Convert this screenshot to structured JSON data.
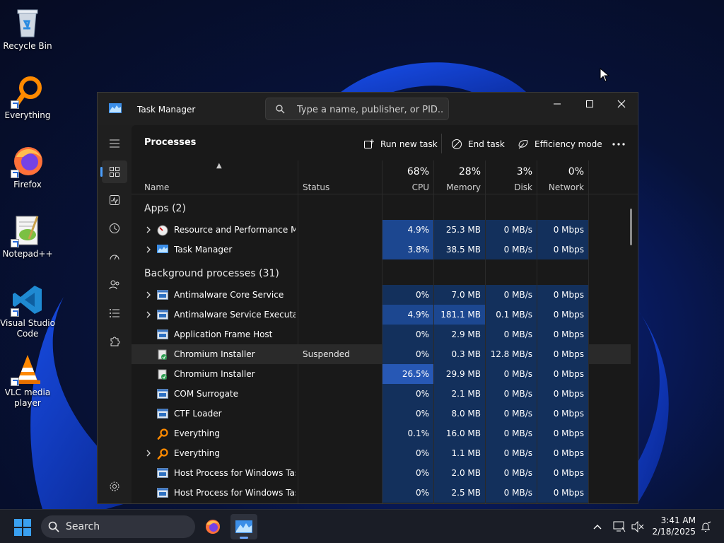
{
  "desktop": {
    "icons": [
      {
        "label": "Recycle Bin",
        "icon": "recycle-bin-icon"
      },
      {
        "label": "Everything",
        "icon": "everything-icon"
      },
      {
        "label": "Firefox",
        "icon": "firefox-icon"
      },
      {
        "label": "Notepad++",
        "icon": "notepadpp-icon"
      },
      {
        "label": "Visual Studio Code",
        "icon": "vscode-icon"
      },
      {
        "label": "VLC media player",
        "icon": "vlc-icon"
      }
    ]
  },
  "window": {
    "title": "Task Manager",
    "search_placeholder": "Type a name, publisher, or PID..."
  },
  "toolbar": {
    "page_title": "Processes",
    "run_new_task": "Run new task",
    "end_task": "End task",
    "efficiency_mode": "Efficiency mode"
  },
  "table": {
    "columns": {
      "name": "Name",
      "status": "Status",
      "cpu": {
        "pct": "68%",
        "label": "CPU"
      },
      "memory": {
        "pct": "28%",
        "label": "Memory"
      },
      "disk": {
        "pct": "3%",
        "label": "Disk"
      },
      "network": {
        "pct": "0%",
        "label": "Network"
      }
    },
    "groups": {
      "apps": "Apps (2)",
      "background": "Background processes (31)"
    },
    "rows": [
      {
        "name": "Resource and Performance M...",
        "status": "",
        "cpu": "4.9%",
        "memory": "25.3 MB",
        "disk": "0 MB/s",
        "network": "0 Mbps",
        "icon": "resource-monitor-icon",
        "expandable": true
      },
      {
        "name": "Task Manager",
        "status": "",
        "cpu": "3.8%",
        "memory": "38.5 MB",
        "disk": "0 MB/s",
        "network": "0 Mbps",
        "icon": "task-manager-icon",
        "expandable": true
      },
      {
        "name": "Antimalware Core Service",
        "status": "",
        "cpu": "0%",
        "memory": "7.0 MB",
        "disk": "0 MB/s",
        "network": "0 Mbps",
        "icon": "service-window-icon",
        "expandable": true
      },
      {
        "name": "Antimalware Service Executable",
        "status": "",
        "cpu": "4.9%",
        "memory": "181.1 MB",
        "disk": "0.1 MB/s",
        "network": "0 Mbps",
        "icon": "service-window-icon",
        "expandable": true
      },
      {
        "name": "Application Frame Host",
        "status": "",
        "cpu": "0%",
        "memory": "2.9 MB",
        "disk": "0 MB/s",
        "network": "0 Mbps",
        "icon": "service-window-icon",
        "expandable": false
      },
      {
        "name": "Chromium Installer",
        "status": "Suspended",
        "cpu": "0%",
        "memory": "0.3 MB",
        "disk": "12.8 MB/s",
        "network": "0 Mbps",
        "icon": "installer-icon",
        "expandable": false
      },
      {
        "name": "Chromium Installer",
        "status": "",
        "cpu": "26.5%",
        "memory": "29.9 MB",
        "disk": "0 MB/s",
        "network": "0 Mbps",
        "icon": "installer-icon",
        "expandable": false
      },
      {
        "name": "COM Surrogate",
        "status": "",
        "cpu": "0%",
        "memory": "2.1 MB",
        "disk": "0 MB/s",
        "network": "0 Mbps",
        "icon": "service-window-icon",
        "expandable": false
      },
      {
        "name": "CTF Loader",
        "status": "",
        "cpu": "0%",
        "memory": "8.0 MB",
        "disk": "0 MB/s",
        "network": "0 Mbps",
        "icon": "service-window-icon",
        "expandable": false
      },
      {
        "name": "Everything",
        "status": "",
        "cpu": "0.1%",
        "memory": "16.0 MB",
        "disk": "0 MB/s",
        "network": "0 Mbps",
        "icon": "everything-icon",
        "expandable": false
      },
      {
        "name": "Everything",
        "status": "",
        "cpu": "0%",
        "memory": "1.1 MB",
        "disk": "0 MB/s",
        "network": "0 Mbps",
        "icon": "everything-icon",
        "expandable": true
      },
      {
        "name": "Host Process for Windows Tasks",
        "status": "",
        "cpu": "0%",
        "memory": "2.0 MB",
        "disk": "0 MB/s",
        "network": "0 Mbps",
        "icon": "service-window-icon",
        "expandable": false
      },
      {
        "name": "Host Process for Windows Tasks",
        "status": "",
        "cpu": "0%",
        "memory": "2.5 MB",
        "disk": "0 MB/s",
        "network": "0 Mbps",
        "icon": "service-window-icon",
        "expandable": false
      }
    ]
  },
  "taskbar": {
    "search_label": "Search",
    "time": "3:41 AM",
    "date": "2/18/2025"
  },
  "colors": {
    "accent": "#4ba0ff",
    "heat_low": "#13305c",
    "heat_mid": "#1c4790",
    "heat_high": "#2758b5"
  }
}
